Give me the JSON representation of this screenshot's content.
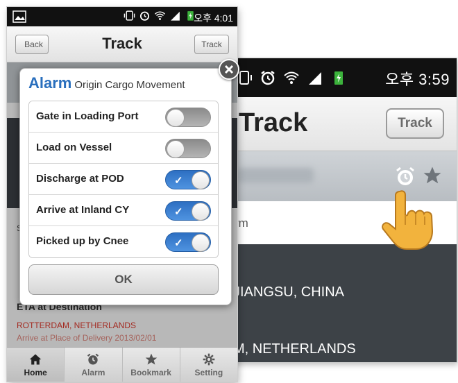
{
  "right_screen": {
    "status_time": "오후 3:59",
    "header_title": "Track",
    "track_button": "Track",
    "term_text": "rm",
    "origin_text": "JIANGSU, CHINA",
    "destination_text": "M, NETHERLANDS"
  },
  "left_screen": {
    "status_time": "오후 4:01",
    "header": {
      "back_label": "Back",
      "title": "Track",
      "track_label": "Track"
    },
    "background": {
      "small_text": "S",
      "eta_label": "ETA at Destination",
      "destination": "ROTTERDAM, NETHERLANDS",
      "arrive_text": "Arrive at Place of Delivery  2013/02/01"
    },
    "dialog": {
      "title": "Alarm",
      "subtitle": "Origin Cargo Movement",
      "options": [
        {
          "label": "Gate in Loading Port",
          "enabled": false
        },
        {
          "label": "Load on Vessel",
          "enabled": false
        },
        {
          "label": "Discharge at POD",
          "enabled": true
        },
        {
          "label": "Arrive at Inland CY",
          "enabled": true
        },
        {
          "label": "Picked up by Cnee",
          "enabled": true
        }
      ],
      "ok_label": "OK",
      "check_glyph": "✓"
    },
    "tabs": [
      {
        "label": "Home",
        "icon": "home-icon",
        "active": true
      },
      {
        "label": "Alarm",
        "icon": "alarm-clock-icon",
        "active": false
      },
      {
        "label": "Bookmark",
        "icon": "star-icon",
        "active": false
      },
      {
        "label": "Setting",
        "icon": "gear-icon",
        "active": false
      }
    ]
  },
  "colors": {
    "accent_blue": "#2a6fbd",
    "toggle_on": "#3a80d2",
    "destination_red": "#e23b2e",
    "dark_panel": "#3d4247"
  }
}
